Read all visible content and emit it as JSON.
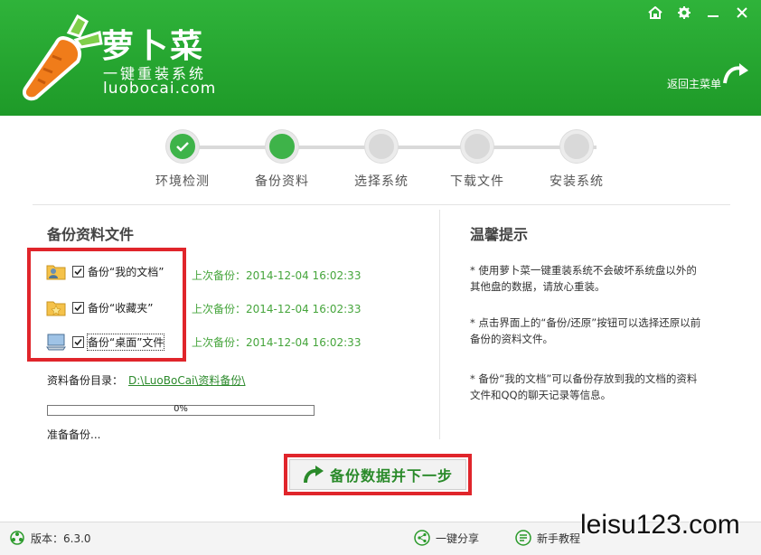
{
  "header": {
    "app_name": "萝卜菜",
    "tagline": "一键重装系统",
    "url": "luobocai.com",
    "back_main_label": "返回主菜单",
    "controls": [
      "home-icon",
      "gear-icon",
      "minimize-icon",
      "close-icon"
    ],
    "brand_color": "#22a22d"
  },
  "steps": [
    {
      "label": "环境检测",
      "state": "done"
    },
    {
      "label": "备份资料",
      "state": "active"
    },
    {
      "label": "选择系统",
      "state": "pending"
    },
    {
      "label": "下载文件",
      "state": "pending"
    },
    {
      "label": "安装系统",
      "state": "pending"
    }
  ],
  "backup": {
    "title": "备份资料文件",
    "items": [
      {
        "label": "备份“我的文档”",
        "checked": true,
        "icon": "user-folder-icon",
        "last": "上次备份：2014-12-04 16:02:33"
      },
      {
        "label": "备份“收藏夹”",
        "checked": true,
        "icon": "favorites-folder-icon",
        "last": "上次备份：2014-12-04 16:02:33"
      },
      {
        "label": "备份“桌面”文件",
        "checked": true,
        "icon": "desktop-icon",
        "last": "上次备份：2014-12-04 16:02:33"
      }
    ],
    "dir_label": "资料备份目录：",
    "dir_path": "D:\\LuoBoCai\\资料备份\\",
    "progress": 0,
    "progress_text": "0%",
    "status": "准备备份..."
  },
  "tips": {
    "title": "温馨提示",
    "items": [
      "* 使用萝卜菜一键重装系统不会破坏系统盘以外的其他盘的数据，请放心重装。",
      "* 点击界面上的“备份/还原”按钮可以选择还原以前备份的资料文件。",
      "* 备份“我的文档”可以备份存放到我的文档的资料文件和QQ的聊天记录等信息。"
    ]
  },
  "next_button": {
    "label": "备份数据并下一步"
  },
  "footer": {
    "version": "版本：6.3.0",
    "share": "一键分享",
    "tutorial": "新手教程"
  },
  "watermark": "leisu123.com"
}
